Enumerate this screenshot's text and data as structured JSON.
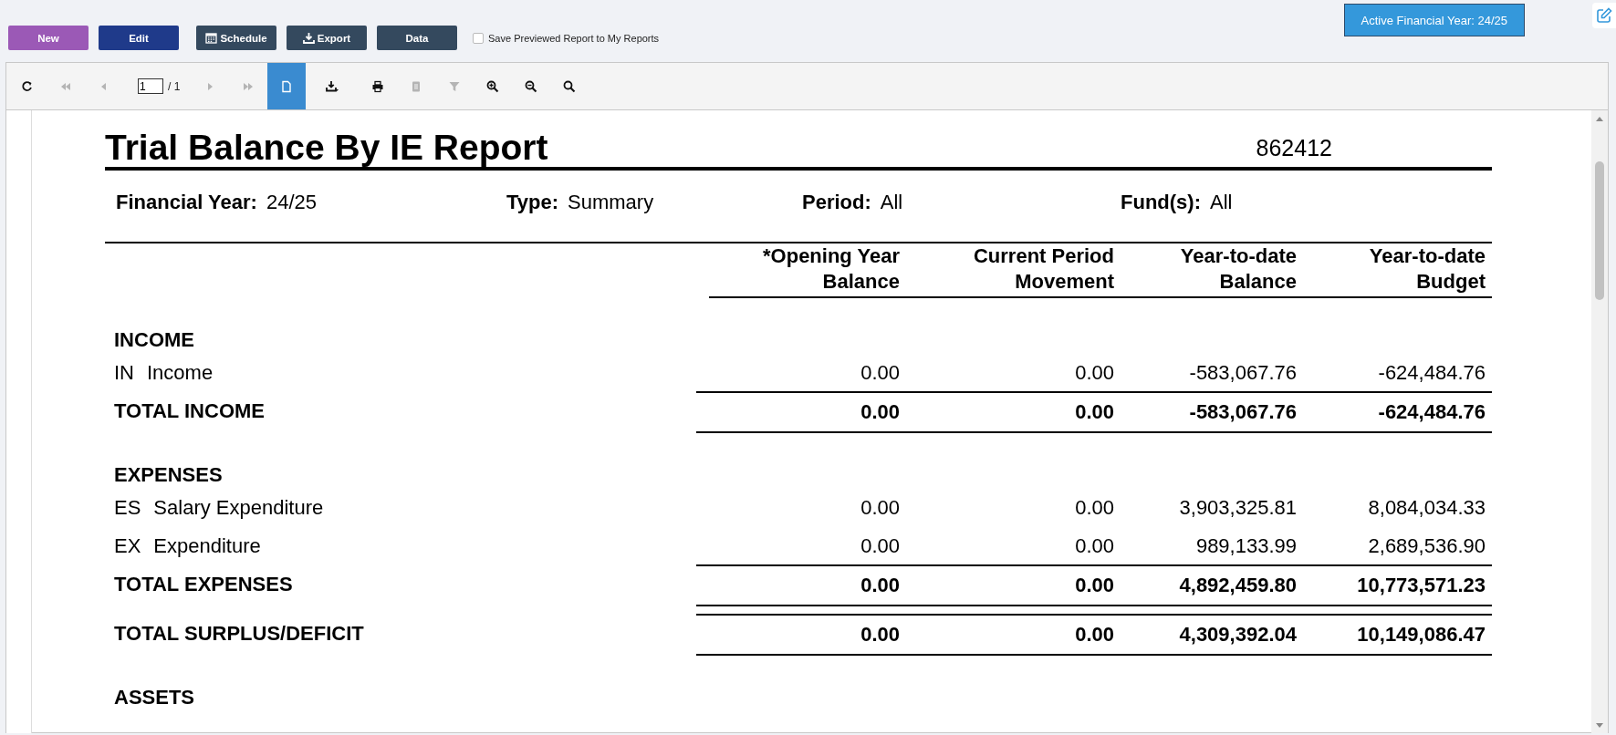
{
  "toolbar": {
    "buttons": [
      {
        "label": "New",
        "color": "#9b59b6",
        "kind": "plain"
      },
      {
        "label": "Edit",
        "color": "#1f3a8a",
        "kind": "plain"
      },
      {
        "label": "Schedule",
        "color": "#34495e",
        "kind": "schedule"
      },
      {
        "label": "Export",
        "color": "#34495e",
        "kind": "export"
      },
      {
        "label": "Data",
        "color": "#34495e",
        "kind": "plain"
      }
    ],
    "save_option": {
      "label": "Save Previewed Report to My Reports",
      "checked": false
    },
    "active_year": "Active Financial Year: 24/25"
  },
  "viewer": {
    "tools": [
      {
        "kind": "refresh",
        "disabled": false,
        "selected": false
      },
      {
        "kind": "first",
        "disabled": true,
        "selected": false
      },
      {
        "kind": "prev",
        "disabled": true,
        "selected": false
      },
      {
        "kind": "page",
        "value": "1",
        "total": "/ 1"
      },
      {
        "kind": "next",
        "disabled": true,
        "selected": false
      },
      {
        "kind": "last",
        "disabled": true,
        "selected": false
      },
      {
        "kind": "single-page",
        "disabled": false,
        "selected": true
      },
      {
        "kind": "export",
        "disabled": false,
        "selected": false
      },
      {
        "kind": "print",
        "disabled": false,
        "selected": false
      },
      {
        "kind": "copy",
        "disabled": true,
        "selected": false
      },
      {
        "kind": "filter",
        "disabled": true,
        "selected": false
      },
      {
        "kind": "zoom-in",
        "disabled": false,
        "selected": false
      },
      {
        "kind": "zoom-out",
        "disabled": false,
        "selected": false
      },
      {
        "kind": "zoom",
        "disabled": false,
        "selected": false
      }
    ]
  },
  "report": {
    "title": "Trial Balance By IE Report",
    "number": "862412",
    "filters": [
      {
        "label": "Financial Year:",
        "value": "24/25"
      },
      {
        "label": "Type:",
        "value": "Summary"
      },
      {
        "label": "Period:",
        "value": "All"
      },
      {
        "label": "Fund(s):",
        "value": "All"
      }
    ],
    "columns": [
      "*Opening Year Balance",
      "Current Period Movement",
      "Year-to-date Balance",
      "Year-to-date Budget"
    ],
    "rows": [
      {
        "kind": "section",
        "label": "INCOME"
      },
      {
        "kind": "line",
        "code": "IN",
        "label": "Income",
        "values": [
          "0.00",
          "0.00",
          "-583,067.76",
          "-624,484.76"
        ]
      },
      {
        "kind": "total",
        "label": "TOTAL INCOME",
        "values": [
          "0.00",
          "0.00",
          "-583,067.76",
          "-624,484.76"
        ]
      },
      {
        "kind": "section",
        "label": "EXPENSES"
      },
      {
        "kind": "line",
        "code": "ES",
        "label": "Salary Expenditure",
        "values": [
          "0.00",
          "0.00",
          "3,903,325.81",
          "8,084,034.33"
        ]
      },
      {
        "kind": "line",
        "code": "EX",
        "label": "Expenditure",
        "values": [
          "0.00",
          "0.00",
          "989,133.99",
          "2,689,536.90"
        ]
      },
      {
        "kind": "total",
        "label": "TOTAL EXPENSES",
        "values": [
          "0.00",
          "0.00",
          "4,892,459.80",
          "10,773,571.23"
        ]
      },
      {
        "kind": "total",
        "label": "TOTAL SURPLUS/DEFICIT",
        "values": [
          "0.00",
          "0.00",
          "4,309,392.04",
          "10,149,086.47"
        ]
      },
      {
        "kind": "section",
        "label": "ASSETS"
      }
    ]
  }
}
